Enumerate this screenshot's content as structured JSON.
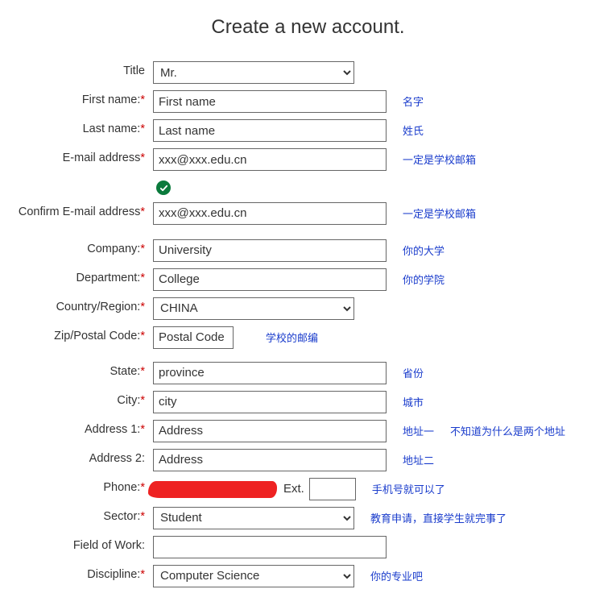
{
  "heading": "Create a new account.",
  "fields": {
    "title": {
      "label": "Title",
      "value": "Mr.",
      "required": false
    },
    "first_name": {
      "label": "First name:",
      "value": "First name",
      "required": true,
      "hint": "名字"
    },
    "last_name": {
      "label": "Last name:",
      "value": "Last name",
      "required": true,
      "hint": "姓氏"
    },
    "email": {
      "label": "E-mail address",
      "value": "xxx@xxx.edu.cn",
      "required": true,
      "hint": "一定是学校邮箱"
    },
    "confirm_email": {
      "label": "Confirm E-mail address",
      "value": "xxx@xxx.edu.cn",
      "required": true,
      "hint": "一定是学校邮箱"
    },
    "company": {
      "label": "Company:",
      "value": "University",
      "required": true,
      "hint": "你的大学"
    },
    "department": {
      "label": "Department:",
      "value": "College",
      "required": true,
      "hint": "你的学院"
    },
    "country": {
      "label": "Country/Region:",
      "value": "CHINA",
      "required": true
    },
    "zip": {
      "label": "Zip/Postal Code:",
      "value": "Postal Code",
      "required": true,
      "hint": "学校的邮编"
    },
    "state": {
      "label": "State:",
      "value": "province",
      "required": true,
      "hint": "省份"
    },
    "city": {
      "label": "City:",
      "value": "city",
      "required": true,
      "hint": "城市"
    },
    "address1": {
      "label": "Address 1:",
      "value": "Address",
      "required": true,
      "hint": "地址一",
      "extra_hint": "不知道为什么是两个地址"
    },
    "address2": {
      "label": "Address 2:",
      "value": "Address",
      "required": false,
      "hint": "地址二"
    },
    "phone": {
      "label": "Phone:",
      "value": "",
      "required": true,
      "ext_label": "Ext.",
      "ext_value": "",
      "hint": "手机号就可以了"
    },
    "sector": {
      "label": "Sector:",
      "value": "Student",
      "required": true,
      "hint": "教育申请，直接学生就完事了"
    },
    "field_of_work": {
      "label": "Field of Work:",
      "value": "",
      "required": false
    },
    "discipline": {
      "label": "Discipline:",
      "value": "Computer Science",
      "required": true,
      "hint": "你的专业吧"
    }
  },
  "required_mark": "*",
  "icons": {
    "valid_check": "check-icon"
  }
}
